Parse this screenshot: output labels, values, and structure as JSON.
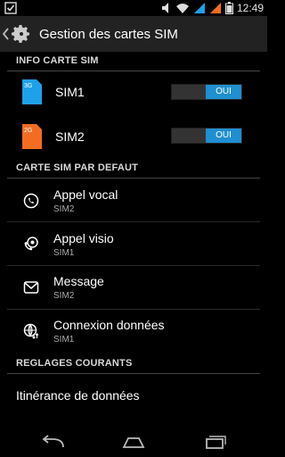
{
  "status_bar": {
    "time": "12:49"
  },
  "action_bar": {
    "title": "Gestion des cartes SIM"
  },
  "sections": {
    "info_sim": "INFO CARTE SIM",
    "default_sim": "CARTE SIM PAR DEFAUT",
    "common": "REGLAGES COURANTS"
  },
  "sims": [
    {
      "badge": "3G",
      "name": "SIM1",
      "toggle_label": "OUI",
      "color": "#1ea1e8"
    },
    {
      "badge": "2G",
      "name": "SIM2",
      "toggle_label": "OUI",
      "color": "#f26d22"
    }
  ],
  "defaults": [
    {
      "title": "Appel vocal",
      "sub": "SIM2",
      "icon": "voice-call-icon"
    },
    {
      "title": "Appel visio",
      "sub": "SIM1",
      "icon": "video-call-icon"
    },
    {
      "title": "Message",
      "sub": "SIM2",
      "icon": "message-icon"
    },
    {
      "title": "Connexion données",
      "sub": "SIM1",
      "icon": "data-connection-icon"
    }
  ],
  "common_settings": [
    {
      "title": "Itinérance de données"
    }
  ],
  "colors": {
    "accent": "#1f8fd0",
    "background": "#000000",
    "action_bar": "#222222"
  }
}
